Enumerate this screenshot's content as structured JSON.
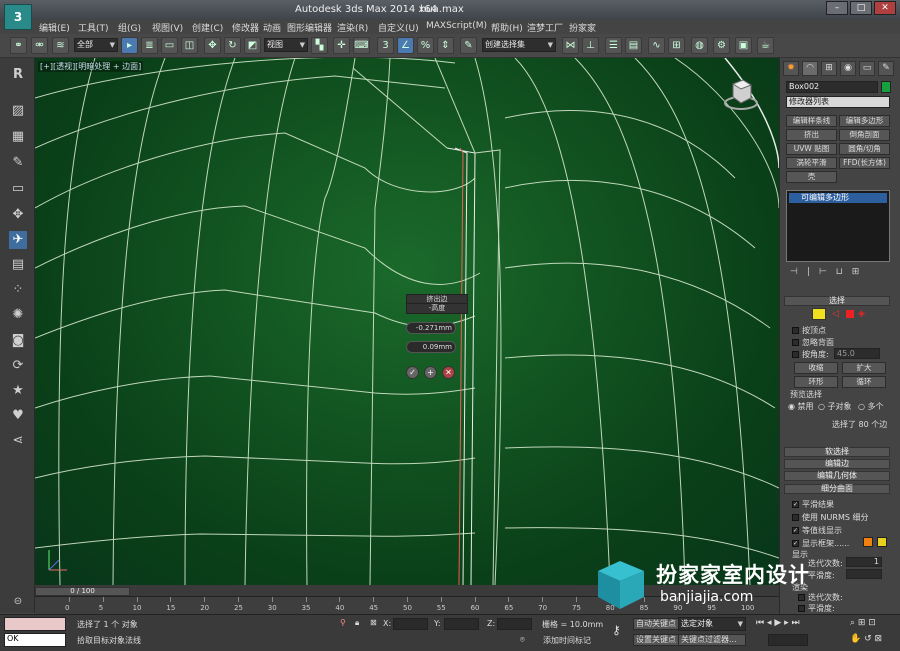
{
  "app": {
    "title": "Autodesk 3ds Max  2014 x64",
    "file": "hua.max",
    "logo": "3"
  },
  "menu": [
    "编辑(E)",
    "工具(T)",
    "组(G)",
    "视图(V)",
    "创建(C)",
    "修改器",
    "动画",
    "图形编辑器",
    "渲染(R)",
    "自定义(U)",
    "MAXScript(M)",
    "帮助(H)",
    "渲梦工厂",
    "扮家家"
  ],
  "toolbar": {
    "filter": "全部",
    "coord": "视图",
    "selset": "创建选择集"
  },
  "viewport": {
    "label": "[+][透视][明暗处理 + 边面]",
    "caddy": {
      "title1": "挤出边",
      "title2": "-高度",
      "height": "-0.271mm",
      "width": "0.09mm"
    }
  },
  "timeline": {
    "slider": "0 / 100",
    "ticks": [
      0,
      5,
      10,
      15,
      20,
      25,
      30,
      35,
      40,
      45,
      50,
      55,
      60,
      65,
      70,
      75,
      80,
      85,
      90,
      95,
      100
    ]
  },
  "status": {
    "selected": "选择了 1 个 对象",
    "prompt": "拾取目标对象法线",
    "x_label": "X:",
    "y_label": "Y:",
    "z_label": "Z:",
    "grid": "栅格 = 10.0mm",
    "autokey": "自动关键点",
    "setkey": "设置关键点",
    "keymode": "选定对象",
    "keyfilter": "关键点过滤器...",
    "add_marker": "添加时间标记",
    "ok": "OK"
  },
  "panel": {
    "object_name": "Box002",
    "modifier_list": "修改器列表",
    "buttons": [
      "编辑样条线",
      "编辑多边形",
      "挤出",
      "倒角剖面",
      "UVW 贴图",
      "圆角/切角",
      "涡轮平滑",
      "FFD(长方体)",
      "壳"
    ],
    "stack_item": "可编辑多边形",
    "rollouts": {
      "select": "选择",
      "by_vertex": "按顶点",
      "ignore_back": "忽略背面",
      "by_angle": "按角度:",
      "angle": "45.0",
      "shrink": "收缩",
      "grow": "扩大",
      "ring": "环形",
      "loop": "循环",
      "preview": "预览选择",
      "disable": "禁用",
      "subobj": "子对象",
      "multi": "多个",
      "selinfo": "选择了 80 个边",
      "soft": "软选择",
      "edit_edges": "编辑边",
      "edit_geom": "编辑几何体",
      "subdiv": "细分曲面",
      "smooth": "平滑结果",
      "nurms": "使用 NURMS 细分",
      "isoline": "等值线显示",
      "cage": "显示框架......",
      "display": "显示",
      "iter": "迭代次数:",
      "iter_val": "1",
      "smooth_lbl": "平滑度:",
      "render_lbl": "渲染",
      "iter2": "迭代次数:",
      "smooth2": "平滑度:"
    }
  },
  "watermark": {
    "cn": "扮家家室内设计",
    "en": "banjiajia.com"
  },
  "colors": {
    "viewport_bg": "#0d4a1d",
    "wire": "#d8e8d0",
    "panel": "#444444",
    "object": "#18a040"
  }
}
